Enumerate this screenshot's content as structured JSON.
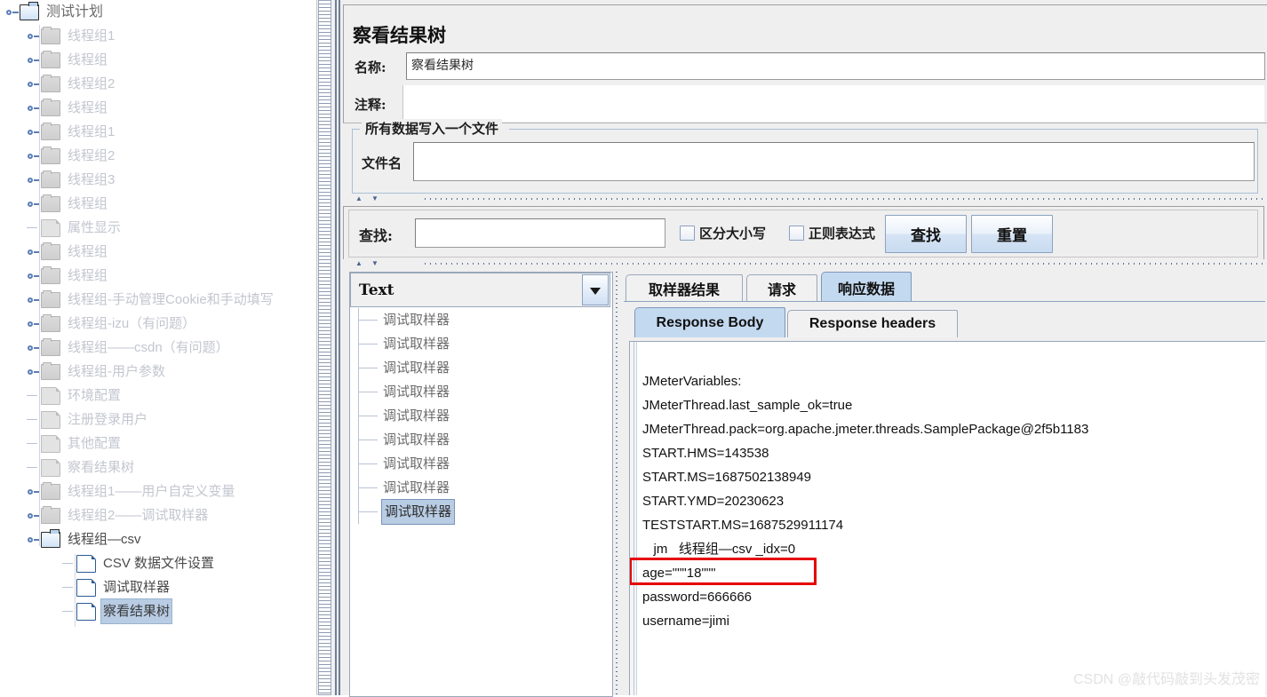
{
  "tree": {
    "root": {
      "label": "测试计划",
      "icon": "folder-open-icon"
    },
    "items": [
      {
        "label": "线程组1",
        "icon": "folder-icon",
        "expandable": true,
        "state": "dim"
      },
      {
        "label": "线程组",
        "icon": "folder-icon",
        "expandable": true,
        "state": "dim"
      },
      {
        "label": "线程组2",
        "icon": "folder-icon",
        "expandable": true,
        "state": "dim"
      },
      {
        "label": "线程组",
        "icon": "folder-icon",
        "expandable": true,
        "state": "dim"
      },
      {
        "label": "线程组1",
        "icon": "folder-icon",
        "expandable": true,
        "state": "dim"
      },
      {
        "label": "线程组2",
        "icon": "folder-icon",
        "expandable": true,
        "state": "dim"
      },
      {
        "label": "线程组3",
        "icon": "folder-icon",
        "expandable": true,
        "state": "dim"
      },
      {
        "label": "线程组",
        "icon": "folder-icon",
        "expandable": true,
        "state": "dim"
      },
      {
        "label": "属性显示",
        "icon": "page-icon",
        "expandable": false,
        "state": "dim"
      },
      {
        "label": "线程组",
        "icon": "folder-icon",
        "expandable": true,
        "state": "dim"
      },
      {
        "label": "线程组",
        "icon": "folder-icon",
        "expandable": true,
        "state": "dim"
      },
      {
        "label": "线程组-手动管理Cookie和手动填写",
        "icon": "folder-icon",
        "expandable": true,
        "state": "dim"
      },
      {
        "label": "线程组-izu（有问题）",
        "icon": "folder-icon",
        "expandable": true,
        "state": "dim"
      },
      {
        "label": "线程组——csdn（有问题）",
        "icon": "folder-icon",
        "expandable": true,
        "state": "dim"
      },
      {
        "label": "线程组-用户参数",
        "icon": "folder-icon",
        "expandable": true,
        "state": "dim"
      },
      {
        "label": "环境配置",
        "icon": "page-icon",
        "expandable": false,
        "state": "dim"
      },
      {
        "label": "注册登录用户",
        "icon": "page-icon",
        "expandable": false,
        "state": "dim"
      },
      {
        "label": "其他配置",
        "icon": "page-icon",
        "expandable": false,
        "state": "dim"
      },
      {
        "label": "察看结果树",
        "icon": "page-icon",
        "expandable": false,
        "state": "dim"
      },
      {
        "label": "线程组1——用户自定义变量",
        "icon": "folder-icon",
        "expandable": true,
        "state": "dim"
      },
      {
        "label": "线程组2——调试取样器",
        "icon": "folder-icon",
        "expandable": true,
        "state": "dim"
      },
      {
        "label": "线程组—csv",
        "icon": "folder-open-icon",
        "expandable": true,
        "state": "active"
      },
      {
        "label": "CSV 数据文件设置",
        "icon": "page-active-icon",
        "expandable": false,
        "state": "active",
        "indent": 1
      },
      {
        "label": "调试取样器",
        "icon": "page-active-icon",
        "expandable": false,
        "state": "active",
        "indent": 1
      },
      {
        "label": "察看结果树",
        "icon": "page-active-icon",
        "expandable": false,
        "state": "selected",
        "indent": 1
      }
    ]
  },
  "panel": {
    "title": "察看结果树",
    "name_label": "名称:",
    "name_value": "察看结果树",
    "comment_label": "注释:",
    "comment_value": "",
    "group_legend": "所有数据写入一个文件",
    "filename_label": "文件名",
    "filename_value": ""
  },
  "find": {
    "label": "查找:",
    "query_value": "",
    "case_sensitive_label": "区分大小写",
    "case_sensitive_checked": false,
    "regex_label": "正则表达式",
    "regex_checked": false,
    "find_button": "查找",
    "reset_button": "重置"
  },
  "sampler": {
    "render_selected": "Text",
    "render_options": [
      "Text"
    ],
    "items": [
      {
        "label": "调试取样器",
        "selected": false
      },
      {
        "label": "调试取样器",
        "selected": false
      },
      {
        "label": "调试取样器",
        "selected": false
      },
      {
        "label": "调试取样器",
        "selected": false
      },
      {
        "label": "调试取样器",
        "selected": false
      },
      {
        "label": "调试取样器",
        "selected": false
      },
      {
        "label": "调试取样器",
        "selected": false
      },
      {
        "label": "调试取样器",
        "selected": false
      },
      {
        "label": "调试取样器",
        "selected": true
      }
    ]
  },
  "results": {
    "tabs": [
      {
        "label": "取样器结果",
        "active": false
      },
      {
        "label": "请求",
        "active": false
      },
      {
        "label": "响应数据",
        "active": true
      }
    ],
    "subtabs": [
      {
        "label": "Response Body",
        "active": true
      },
      {
        "label": "Response headers",
        "active": false
      }
    ],
    "body_lines": [
      "JMeterVariables:",
      "JMeterThread.last_sample_ok=true",
      "JMeterThread.pack=org.apache.jmeter.threads.SamplePackage@2f5b1183",
      "START.HMS=143538",
      "START.MS=1687502138949",
      "START.YMD=20230623",
      "TESTSTART.MS=1687529911174",
      "   jm   线程组—csv _idx=0",
      "age=\"\"\"18\"\"\"",
      "password=666666",
      "username=jimi"
    ],
    "highlighted_line_index": 8,
    "highlight_color": "#e60000"
  },
  "watermark": "CSDN @敲代码敲到头发茂密",
  "colors": {
    "accent": "#b8cce4",
    "panel_bg": "#efefef",
    "tab_active": "#c3d9f0",
    "tree_dim_text": "#b9bcc6"
  }
}
